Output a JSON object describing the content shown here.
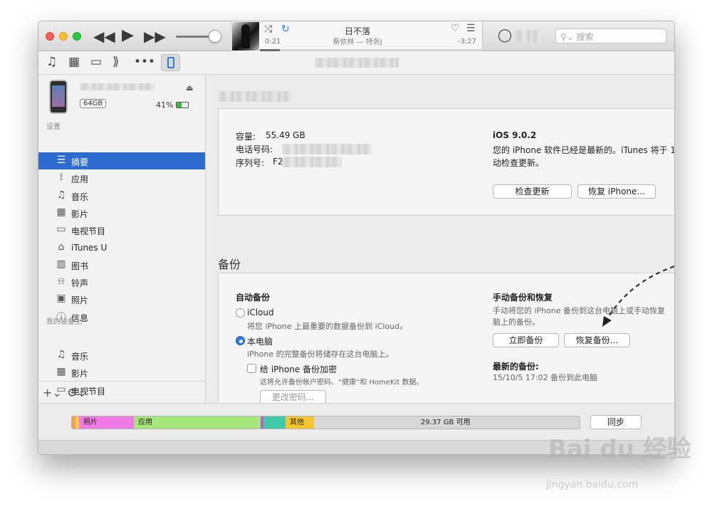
{
  "player": {
    "song_title": "日不落",
    "song_subtitle": "蔡依林 — 特务J",
    "elapsed": "0:21",
    "remaining": "-3:27",
    "progress": 0.09,
    "search_placeholder": "搜索"
  },
  "sidebar": {
    "capacity_badge": "64GB",
    "battery_text": "41%",
    "battery_level": 0.41,
    "settings_heading": "设置",
    "settings_items": [
      {
        "label": "摘要",
        "icon": "summary-icon"
      },
      {
        "label": "应用",
        "icon": "apps-icon"
      },
      {
        "label": "音乐",
        "icon": "music-note-icon"
      },
      {
        "label": "影片",
        "icon": "film-icon"
      },
      {
        "label": "电视节目",
        "icon": "tv-icon"
      },
      {
        "label": "iTunes U",
        "icon": "graduation-cap-icon"
      },
      {
        "label": "图书",
        "icon": "book-icon"
      },
      {
        "label": "铃声",
        "icon": "bell-icon"
      },
      {
        "label": "照片",
        "icon": "camera-icon"
      },
      {
        "label": "信息",
        "icon": "info-icon"
      }
    ],
    "mydevice_heading": "我的设备上",
    "device_items": [
      {
        "label": "音乐",
        "icon": "music-note-icon"
      },
      {
        "label": "影片",
        "icon": "film-icon"
      },
      {
        "label": "电视节目",
        "icon": "tv-icon"
      }
    ]
  },
  "summary": {
    "capacity_label": "容量:",
    "capacity_value": "55.49 GB",
    "phone_label": "电话号码:",
    "serial_label": "序列号:",
    "serial_partial": "F2",
    "ios_version": "iOS 9.0.2",
    "ios_status_line1": "您的 iPhone 软件已经是最新的。iTunes 将于 1",
    "ios_status_line2": "动检查更新。",
    "check_update_btn": "检查更新",
    "restore_iphone_btn": "恢复 iPhone..."
  },
  "backup": {
    "heading": "备份",
    "auto_heading": "自动备份",
    "icloud_label": "iCloud",
    "icloud_desc": "将您 iPhone 上最重要的数据备份到 iCloud。",
    "computer_label": "本电脑",
    "computer_desc": "iPhone 的完整备份将储存在这台电脑上。",
    "encrypt_label": "给 iPhone 备份加密",
    "encrypt_desc": "这将允许备份帐户密码、“健康”和 HomeKit 数据。",
    "change_pwd_btn": "更改密码...",
    "manual_heading": "手动备份和恢复",
    "manual_desc_line1": "手动将您的 iPhone 备份到这台电脑上或手动恢复",
    "manual_desc_line2": "脑上的备份。",
    "backup_now_btn": "立即备份",
    "restore_backup_btn": "恢复备份...",
    "latest_heading": "最新的备份:",
    "latest_value": "15/10/5 17:02 备份到此电脑"
  },
  "storage": {
    "segments": [
      {
        "label": "",
        "color": "#f5a04a"
      },
      {
        "label": "",
        "color": "#f1d24a"
      },
      {
        "label": "照片",
        "color": "#f07be6"
      },
      {
        "label": "应用",
        "color": "#a6e77b"
      },
      {
        "label": "",
        "color": "#c15bd6"
      },
      {
        "label": "",
        "color": "#3fc9a9"
      },
      {
        "label": "其他",
        "color": "#f5c52d"
      }
    ],
    "free_label": "29.37 GB 可用",
    "sync_btn": "同步"
  },
  "watermark": {
    "brand": "Bai du 经验",
    "url": "jingyan.baidu.com"
  }
}
